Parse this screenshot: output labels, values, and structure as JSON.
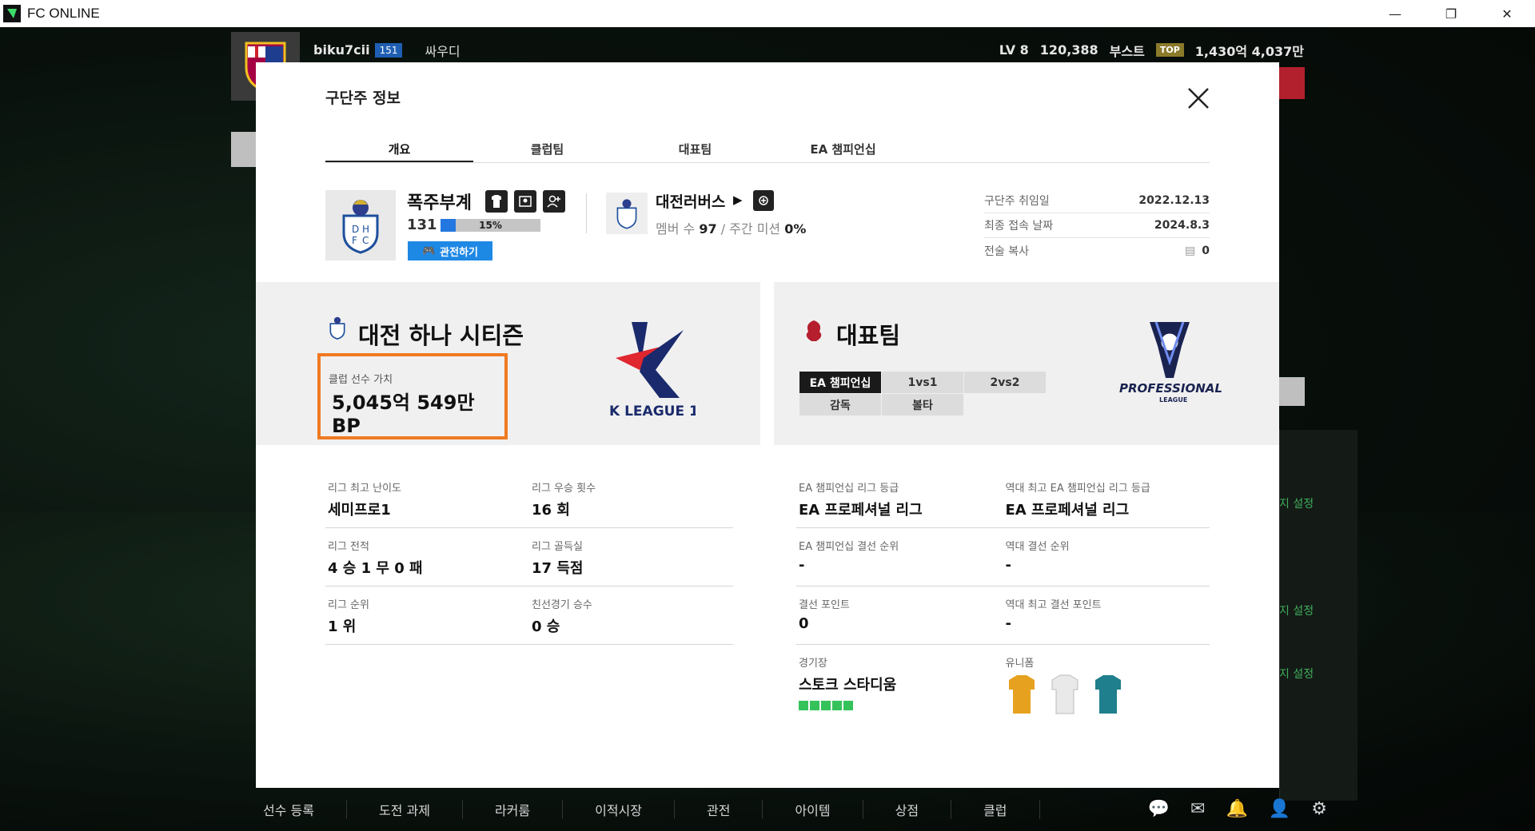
{
  "window": {
    "title": "FC ONLINE"
  },
  "topbar": {
    "username": "biku7cii",
    "user_level": "151",
    "manager": "싸우디",
    "lv": "LV 8",
    "mp": "120,388",
    "boost_label": "부스트",
    "boost_badge": "TOP",
    "bp": "1,430억 4,037만"
  },
  "modal": {
    "title": "구단주 정보",
    "tabs": [
      "개요",
      "클럽팀",
      "대표팀",
      "EA 챔피언십"
    ],
    "club": {
      "name": "폭주부계",
      "level": "131",
      "xp_percent": 15,
      "xp_label": "15%",
      "spectate_label": "관전하기"
    },
    "club2": {
      "name": "대전러버스",
      "members_label": "멤버 수",
      "members": "97",
      "separator": "/",
      "mission_label": "주간 미션",
      "mission": "0%"
    },
    "info": [
      {
        "key": "구단주 취임일",
        "value": "2022.12.13"
      },
      {
        "key": "최종 접속 날짜",
        "value": "2024.8.3"
      },
      {
        "key": "전술 복사",
        "value": "0"
      }
    ],
    "left_panel": {
      "title": "대전 하나 시티즌",
      "value_label": "클럽 선수 가치",
      "value": "5,045억 549만 BP",
      "league_logo_text": "K LEAGUE 1"
    },
    "right_panel": {
      "title": "대표팀",
      "modes": [
        "EA 챔피언십",
        "1vs1",
        "2vs2",
        "감독",
        "볼타"
      ],
      "logo_text": "PROFESSIONAL",
      "logo_sub": "LEAGUE"
    },
    "stats_left": [
      {
        "label": "리그 최고 난이도",
        "value": "세미프로1"
      },
      {
        "label": "리그 우승 횟수",
        "value": "16 회"
      },
      {
        "label": "리그 전적",
        "value": "4 승 1 무 0 패"
      },
      {
        "label": "리그 골득실",
        "value": "17 득점"
      },
      {
        "label": "리그 순위",
        "value": "1 위"
      },
      {
        "label": "친선경기 승수",
        "value": "0 승"
      }
    ],
    "stats_right": [
      {
        "label": "EA 챔피언십 리그 등급",
        "value": "EA 프로페셔널 리그"
      },
      {
        "label": "역대 최고 EA 챔피언십 리그 등급",
        "value": "EA 프로페셔널 리그"
      },
      {
        "label": "EA 챔피언십 결선 순위",
        "value": "-"
      },
      {
        "label": "역대 결선 순위",
        "value": "-"
      },
      {
        "label": "결선 포인트",
        "value": "0"
      },
      {
        "label": "역대 최고 결선 포인트",
        "value": "-"
      },
      {
        "label": "경기장",
        "value": "스토크 스타디움"
      },
      {
        "label": "유니폼",
        "value": ""
      }
    ],
    "stadium_stars": 5
  },
  "side": {
    "link_text": "지 설정"
  },
  "bottom_nav": [
    "선수 등록",
    "도전 과제",
    "라커룸",
    "이적시장",
    "관전",
    "아이템",
    "상점",
    "클럽"
  ]
}
